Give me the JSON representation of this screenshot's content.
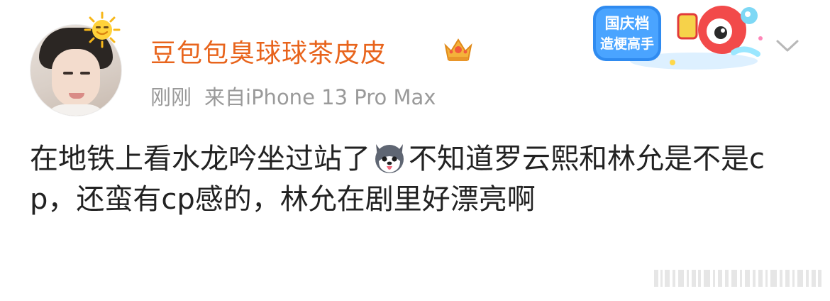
{
  "user": {
    "name": "豆包包臭球球茶皮皮",
    "avatar_icon": "avatar-photo",
    "sun_icon": "sun-badge-icon",
    "vip_icon": "crown-badge-icon"
  },
  "meta": {
    "time": "刚刚",
    "source": "来自iPhone 13 Pro Max"
  },
  "banner": {
    "line1": "国庆档",
    "line2": "造梗高手"
  },
  "post": {
    "text_before_emoji": "在地铁上看水龙吟坐过站了",
    "emoji": "husky-dog-emoji",
    "text_after_emoji": "不知道罗云熙和林允是不是cp，还蛮有cp感的，林允在剧里好漂亮啊"
  },
  "colors": {
    "username": "#e8641c",
    "meta": "#9a9a9a",
    "text": "#222222"
  }
}
